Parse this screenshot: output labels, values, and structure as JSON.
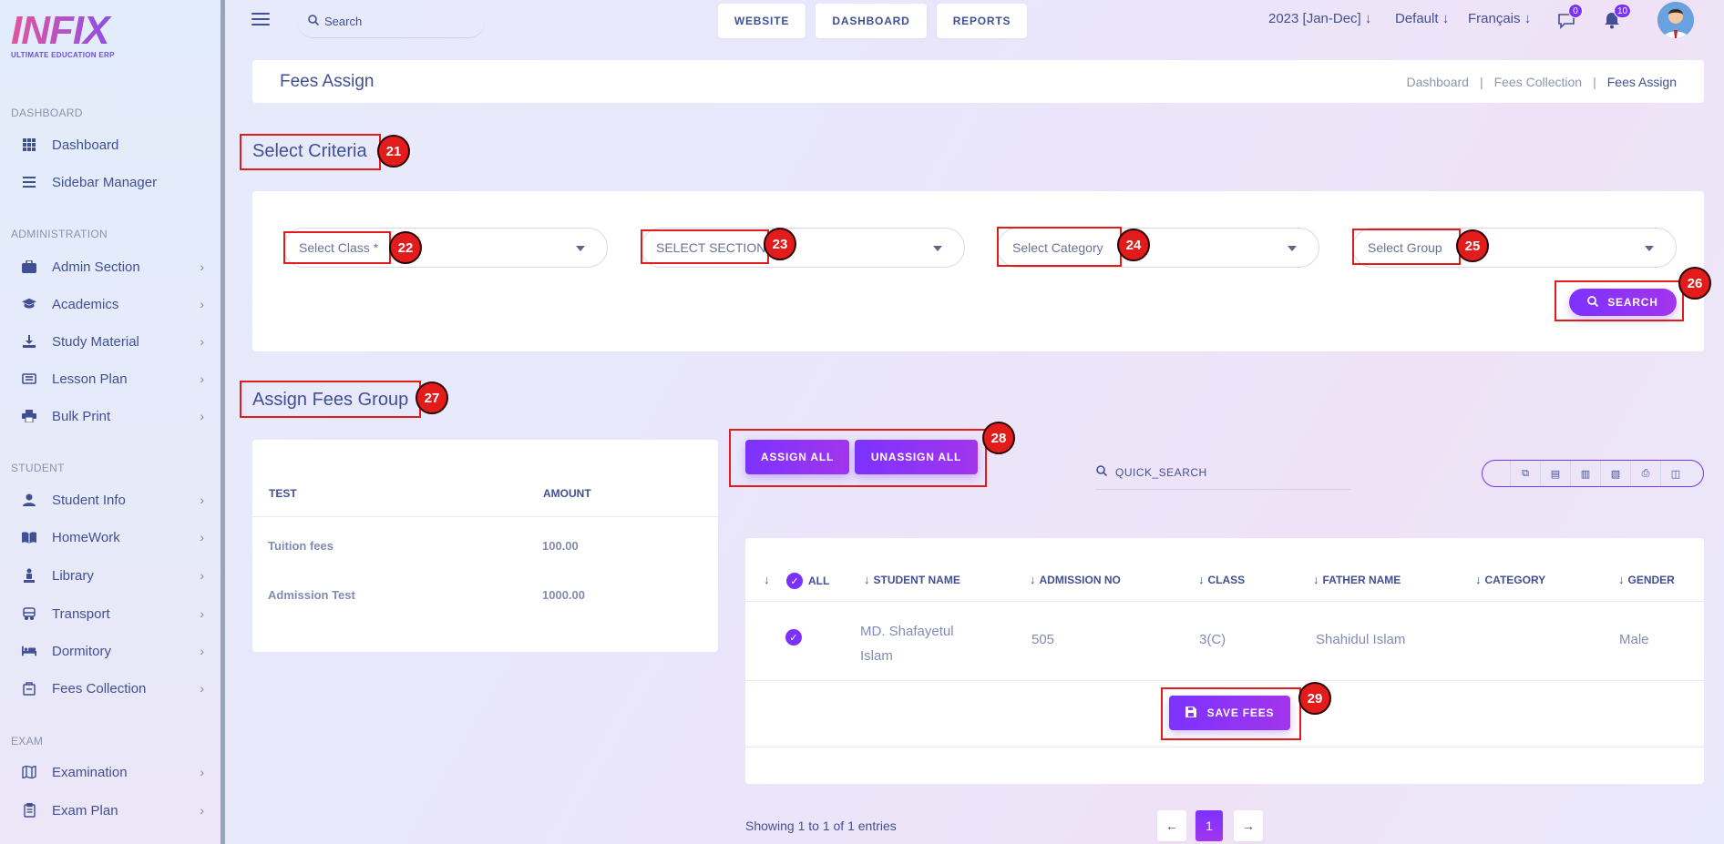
{
  "logo": {
    "text": "INFIX",
    "subtitle": "ULTIMATE EDUCATION ERP"
  },
  "sidebar": {
    "sections": [
      {
        "title": "DASHBOARD",
        "items": [
          {
            "label": "Dashboard",
            "icon": "grid-icon",
            "chevron": false
          },
          {
            "label": "Sidebar Manager",
            "icon": "menu-icon",
            "chevron": false
          }
        ]
      },
      {
        "title": "ADMINISTRATION",
        "items": [
          {
            "label": "Admin Section",
            "icon": "admin-icon",
            "chevron": true
          },
          {
            "label": "Academics",
            "icon": "graduation-cap-icon",
            "chevron": true
          },
          {
            "label": "Study Material",
            "icon": "download-icon",
            "chevron": true
          },
          {
            "label": "Lesson Plan",
            "icon": "list-icon",
            "chevron": true
          },
          {
            "label": "Bulk Print",
            "icon": "printer-icon",
            "chevron": true
          }
        ]
      },
      {
        "title": "STUDENT",
        "items": [
          {
            "label": "Student Info",
            "icon": "user-icon",
            "chevron": true
          },
          {
            "label": "HomeWork",
            "icon": "book-icon",
            "chevron": true
          },
          {
            "label": "Library",
            "icon": "library-icon",
            "chevron": true
          },
          {
            "label": "Transport",
            "icon": "bus-icon",
            "chevron": true
          },
          {
            "label": "Dormitory",
            "icon": "bed-icon",
            "chevron": true
          },
          {
            "label": "Fees Collection",
            "icon": "fees-icon",
            "chevron": true
          }
        ]
      },
      {
        "title": "EXAM",
        "items": [
          {
            "label": "Examination",
            "icon": "map-icon",
            "chevron": true
          },
          {
            "label": "Exam Plan",
            "icon": "clipboard-icon",
            "chevron": true
          }
        ]
      }
    ]
  },
  "topbar": {
    "search_placeholder": "Search",
    "buttons": [
      "WEBSITE",
      "DASHBOARD",
      "REPORTS"
    ],
    "session": "2023 [Jan-Dec]",
    "theme": "Default",
    "language": "Français",
    "messages_count": "0",
    "notifications_count": "10"
  },
  "page": {
    "title": "Fees Assign",
    "breadcrumb": [
      "Dashboard",
      "Fees Collection",
      "Fees Assign"
    ]
  },
  "criteria": {
    "title": "Select Criteria",
    "class_placeholder": "Select Class *",
    "section_placeholder": "SELECT SECTION *",
    "category_placeholder": "Select Category",
    "group_placeholder": "Select Group",
    "search_button": "SEARCH"
  },
  "fees_group": {
    "title": "Assign Fees Group",
    "headers": [
      "TEST",
      "AMOUNT"
    ],
    "rows": [
      {
        "name": "Tuition fees",
        "amount": "100.00"
      },
      {
        "name": "Admission Test",
        "amount": "1000.00"
      }
    ]
  },
  "actions": {
    "assign_all": "ASSIGN ALL",
    "unassign_all": "UNASSIGN ALL",
    "quick_search": "QUICK_SEARCH"
  },
  "students": {
    "headers": {
      "all": "ALL",
      "name": "STUDENT NAME",
      "admission": "ADMISSION NO",
      "class": "CLASS",
      "father": "FATHER NAME",
      "category": "CATEGORY",
      "gender": "GENDER"
    },
    "rows": [
      {
        "name_line1": "MD. Shafayetul",
        "name_line2": "Islam",
        "admission": "505",
        "class": "3(C)",
        "father": "Shahidul Islam",
        "category": "",
        "gender": "Male"
      }
    ],
    "save_button": "SAVE FEES",
    "showing": "Showing 1 to 1 of 1 entries",
    "page": "1"
  },
  "markers": [
    "21",
    "22",
    "23",
    "24",
    "25",
    "26",
    "27",
    "28",
    "29"
  ]
}
